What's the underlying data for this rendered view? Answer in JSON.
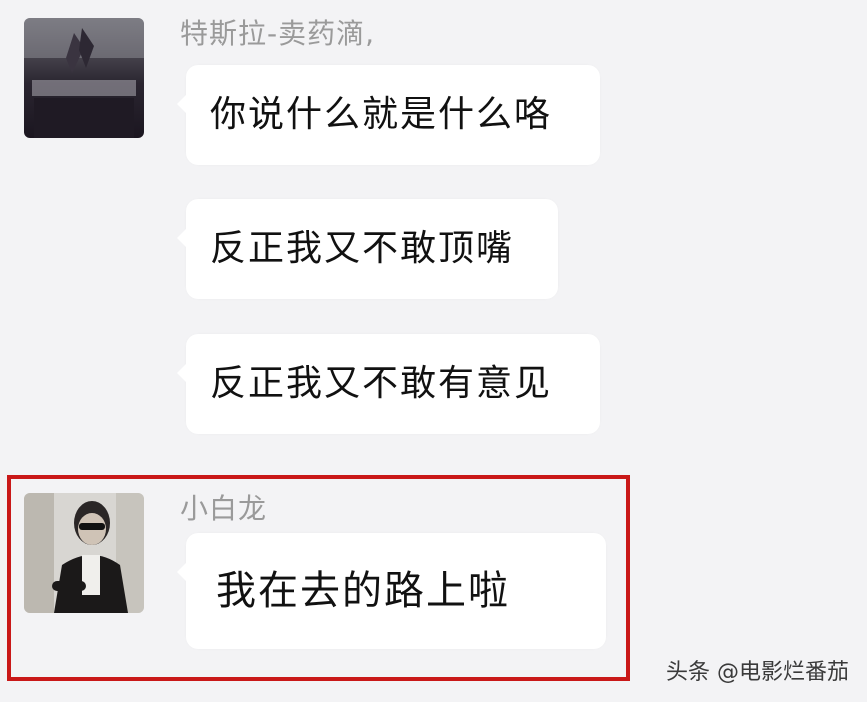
{
  "messages": [
    {
      "sender": "特斯拉-卖药滴,",
      "avatar_icon": "dark-room-photo-avatar",
      "bubbles": [
        "你说什么就是什么咯",
        "反正我又不敢顶嘴",
        "反正我又不敢有意见"
      ]
    },
    {
      "sender": "小白龙",
      "avatar_icon": "man-with-sunglasses-photo-avatar",
      "bubbles": [
        "我在去的路上啦"
      ],
      "highlighted": true
    }
  ],
  "highlight_color": "#c91818",
  "watermark": "头条 @电影烂番茄"
}
